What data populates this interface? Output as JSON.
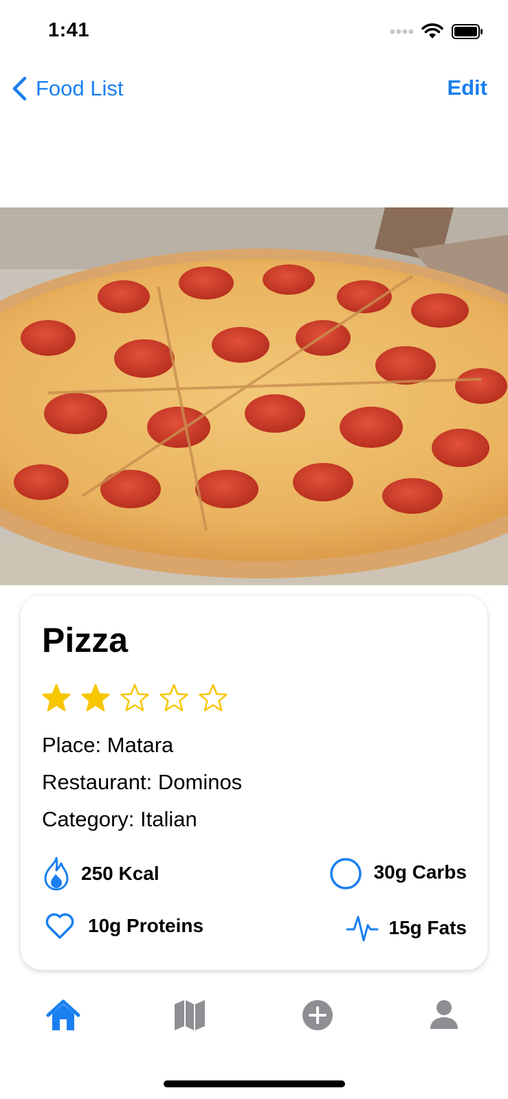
{
  "status_bar": {
    "time": "1:41"
  },
  "nav": {
    "back_label": "Food List",
    "edit_label": "Edit"
  },
  "food": {
    "name": "Pizza",
    "rating": 2,
    "rating_max": 5,
    "place": "Place: Matara",
    "restaurant": "Restaurant: Dominos",
    "category": "Category: Italian"
  },
  "stats": {
    "kcal": "250 Kcal",
    "carbs": "30g Carbs",
    "proteins": "10g Proteins",
    "fats": "15g Fats"
  },
  "colors": {
    "accent": "#1a7ff0",
    "star": "#f7c600",
    "tab_inactive": "#8e8e93"
  },
  "tabs": [
    {
      "icon": "house-icon",
      "active": true
    },
    {
      "icon": "map-icon",
      "active": false
    },
    {
      "icon": "plus-circle-icon",
      "active": false
    },
    {
      "icon": "person-icon",
      "active": false
    }
  ]
}
